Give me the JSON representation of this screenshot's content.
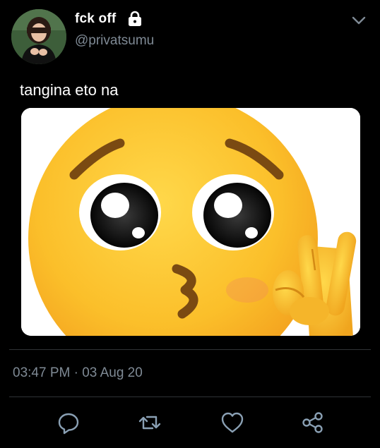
{
  "tweet": {
    "display_name": "fck off",
    "handle": "@privatsumu",
    "text": "tangina eto na",
    "timestamp": "03:47 PM · 03 Aug 20"
  },
  "icons": {
    "lock": "lock-icon",
    "chevron": "chevron-down-icon",
    "reply": "reply-icon",
    "retweet": "retweet-icon",
    "like": "heart-icon",
    "share": "share-icon"
  },
  "colors": {
    "background": "#000000",
    "text_primary": "#ffffff",
    "text_secondary": "#7f8a95",
    "divider": "#2f3336",
    "icon": "#8aa0b4"
  }
}
